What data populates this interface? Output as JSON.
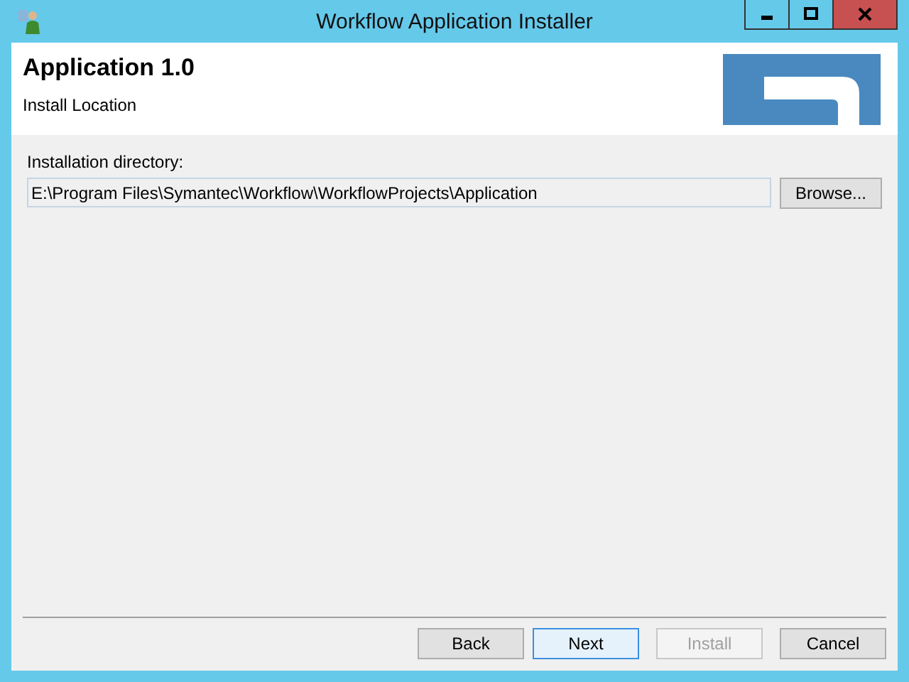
{
  "window": {
    "title": "Workflow Application Installer"
  },
  "header": {
    "title": "Application 1.0",
    "subtitle": "Install Location"
  },
  "directory": {
    "label": "Installation directory:",
    "value": "E:\\Program Files\\Symantec\\Workflow\\WorkflowProjects\\Application",
    "browse": "Browse..."
  },
  "buttons": [
    {
      "label": "Back",
      "disabled": false,
      "focused": false
    },
    {
      "label": "Next",
      "disabled": false,
      "focused": true
    },
    {
      "label": "Install",
      "disabled": true,
      "focused": false
    },
    {
      "label": "Cancel",
      "disabled": false,
      "focused": false
    }
  ]
}
